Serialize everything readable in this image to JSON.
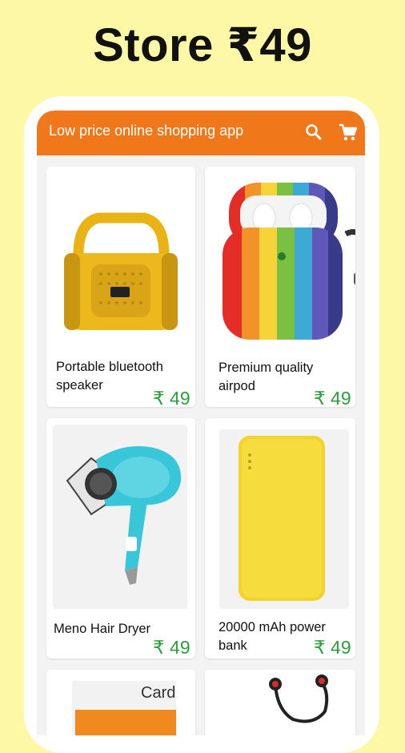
{
  "headline": "Store ₹49",
  "appbar": {
    "title": "Low price online shopping app",
    "search_icon": "search-icon",
    "cart_icon": "cart-icon"
  },
  "colors": {
    "background": "#FDF8A6",
    "appbar": "#F0771A",
    "price": "#2CA03A"
  },
  "products": [
    {
      "name": "Portable bluetooth speaker",
      "price": "₹ 49"
    },
    {
      "name": "Premium quality airpod",
      "price": "₹ 49"
    },
    {
      "name": "Meno Hair Dryer",
      "price": "₹ 49"
    },
    {
      "name": "20000 mAh power bank",
      "price": "₹ 49"
    },
    {
      "card_text": "Card"
    }
  ]
}
